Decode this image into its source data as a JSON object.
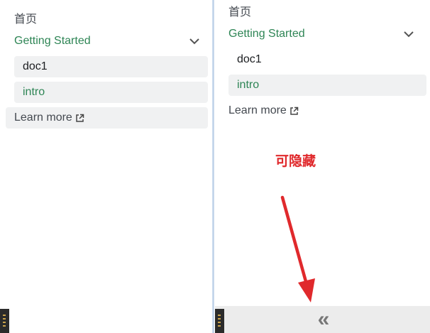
{
  "left": {
    "home": "首页",
    "category": "Getting Started",
    "items": [
      {
        "label": "doc1"
      },
      {
        "label": "intro"
      }
    ],
    "learn_more": "Learn more"
  },
  "right": {
    "home": "首页",
    "category": "Getting Started",
    "items": [
      {
        "label": "doc1"
      },
      {
        "label": "intro"
      }
    ],
    "learn_more": "Learn more"
  },
  "annotation": {
    "text": "可隐藏",
    "color": "#e0292c"
  },
  "collapse": {
    "glyph": "«"
  },
  "colors": {
    "accent": "#2e8555",
    "active_bg": "#f0f1f2"
  }
}
